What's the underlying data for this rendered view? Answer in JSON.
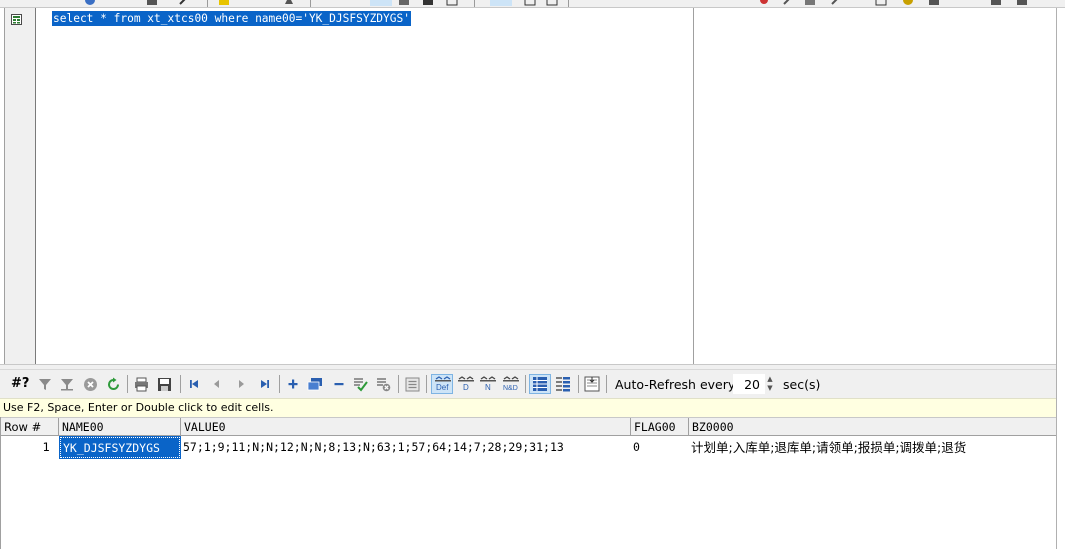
{
  "editor": {
    "sql_text": "select * from xt_xtcs00 where name00='YK_DJSFSYZDYGS'"
  },
  "grid_toolbar": {
    "row_count_label": "#?",
    "auto_refresh_label": "Auto-Refresh every",
    "auto_refresh_value": "20",
    "auto_refresh_unit": "sec(s)",
    "icons": [
      "filter-icon",
      "clear-filter-icon",
      "cancel-query-icon",
      "refresh-icon",
      "print-icon",
      "save-icon",
      "first-record-icon",
      "prior-record-icon",
      "next-record-icon",
      "last-record-icon",
      "insert-record-icon",
      "duplicate-record-icon",
      "delete-record-icon",
      "post-edit-icon",
      "cancel-edit-icon",
      "memo-editor-icon",
      "default-caption-icon",
      "description-caption-icon",
      "name-caption-icon",
      "name-description-caption-icon",
      "grid-view-icon",
      "form-view-icon",
      "auto-fit-icon"
    ]
  },
  "hint": "Use F2, Space, Enter or Double click to edit cells.",
  "grid": {
    "columns": [
      "Row #",
      "NAME00",
      "VALUE0",
      "FLAG00",
      "BZ0000"
    ],
    "rows": [
      [
        "1",
        "YK_DJSFSYZDYGS",
        "57;1;9;11;N;N;12;N;N;8;13;N;63;1;57;64;14;7;28;29;31;13",
        "0",
        "计划单;入库单;退库单;请领单;报损单;调拨单;退货"
      ]
    ]
  },
  "colors": {
    "selection": "#0a64c8",
    "toolbar_bg": "#f0f0f0",
    "hint_bg": "#ffffe1"
  }
}
